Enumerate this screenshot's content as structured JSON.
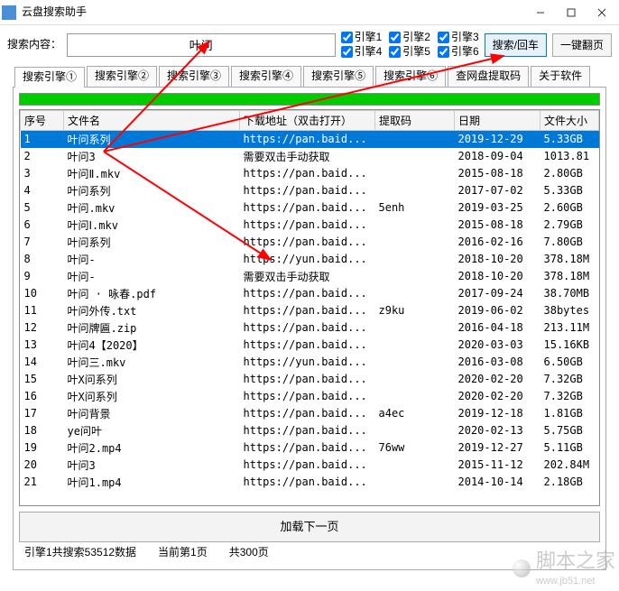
{
  "window": {
    "title": "云盘搜索助手"
  },
  "search": {
    "label": "搜索内容：",
    "value": "叶问",
    "button": "搜索/回车",
    "flip": "一键翻页"
  },
  "engines": [
    "引擎1",
    "引擎2",
    "引擎3",
    "引擎4",
    "引擎5",
    "引擎6"
  ],
  "tabs": [
    "搜索引擎①",
    "搜索引擎②",
    "搜索引擎③",
    "搜索引擎④",
    "搜索引擎⑤",
    "搜索引擎⑥",
    "查网盘提取码",
    "关于软件"
  ],
  "columns": {
    "seq": "序号",
    "name": "文件名",
    "url": "下载地址（双击打开）",
    "code": "提取码",
    "date": "日期",
    "size": "文件大小"
  },
  "rows": [
    {
      "seq": "1",
      "name": "叶问系列",
      "url": "https://pan.baid...",
      "code": "",
      "date": "2019-12-29",
      "size": "5.33GB",
      "sel": true
    },
    {
      "seq": "2",
      "name": "叶问3",
      "url": "需要双击手动获取",
      "code": "",
      "date": "2018-09-04",
      "size": "1013.81"
    },
    {
      "seq": "3",
      "name": "叶问Ⅱ.mkv",
      "url": "https://pan.baid...",
      "code": "",
      "date": "2015-08-18",
      "size": "2.80GB"
    },
    {
      "seq": "4",
      "name": "叶问系列",
      "url": "https://pan.baid...",
      "code": "",
      "date": "2017-07-02",
      "size": "5.33GB"
    },
    {
      "seq": "5",
      "name": "叶问.mkv",
      "url": "https://pan.baid...",
      "code": "5enh",
      "date": "2019-03-25",
      "size": "2.60GB"
    },
    {
      "seq": "6",
      "name": "叶问Ⅰ.mkv",
      "url": "https://pan.baid...",
      "code": "",
      "date": "2015-08-18",
      "size": "2.79GB"
    },
    {
      "seq": "7",
      "name": "叶问系列",
      "url": "https://pan.baid...",
      "code": "",
      "date": "2016-02-16",
      "size": "7.80GB"
    },
    {
      "seq": "8",
      "name": "叶问-",
      "url": "https://yun.baid...",
      "code": "",
      "date": "2018-10-20",
      "size": "378.18M"
    },
    {
      "seq": "9",
      "name": "叶问-",
      "url": "需要双击手动获取",
      "code": "",
      "date": "2018-10-20",
      "size": "378.18M"
    },
    {
      "seq": "10",
      "name": "叶问 · 咏春.pdf",
      "url": "https://pan.baid...",
      "code": "",
      "date": "2017-09-24",
      "size": "38.70MB"
    },
    {
      "seq": "11",
      "name": "叶问外传.txt",
      "url": "https://pan.baid...",
      "code": "z9ku",
      "date": "2019-06-02",
      "size": "38bytes"
    },
    {
      "seq": "12",
      "name": "叶问牌匾.zip",
      "url": "https://pan.baid...",
      "code": "",
      "date": "2016-04-18",
      "size": "213.11M"
    },
    {
      "seq": "13",
      "name": "叶问4【2020】",
      "url": "https://pan.baid...",
      "code": "",
      "date": "2020-03-03",
      "size": "15.16KB"
    },
    {
      "seq": "14",
      "name": "叶问三.mkv",
      "url": "https://yun.baid...",
      "code": "",
      "date": "2016-03-08",
      "size": "6.50GB"
    },
    {
      "seq": "15",
      "name": "叶X问系列",
      "url": "https://pan.baid...",
      "code": "",
      "date": "2020-02-20",
      "size": "7.32GB"
    },
    {
      "seq": "16",
      "name": "叶X问系列",
      "url": "https://pan.baid...",
      "code": "",
      "date": "2020-02-20",
      "size": "7.32GB"
    },
    {
      "seq": "17",
      "name": "叶问背景",
      "url": "https://pan.baid...",
      "code": "a4ec",
      "date": "2019-12-18",
      "size": "1.81GB"
    },
    {
      "seq": "18",
      "name": "ye问叶",
      "url": "https://pan.baid...",
      "code": "",
      "date": "2020-02-13",
      "size": "5.75GB"
    },
    {
      "seq": "19",
      "name": "叶问2.mp4",
      "url": "https://pan.baid...",
      "code": "76ww",
      "date": "2019-12-27",
      "size": "5.11GB"
    },
    {
      "seq": "20",
      "name": "叶问3",
      "url": "https://pan.baid...",
      "code": "",
      "date": "2015-11-12",
      "size": "202.84M"
    },
    {
      "seq": "21",
      "name": "叶问1.mp4",
      "url": "https://pan.baid...",
      "code": "",
      "date": "2014-10-14",
      "size": "2.18GB"
    }
  ],
  "loadmore": "加载下一页",
  "status": {
    "left": "引擎1共搜索53512数据",
    "mid": "当前第1页",
    "right": "共300页"
  },
  "watermark": {
    "site": "脚本之家",
    "url": "www.jb51.net"
  }
}
